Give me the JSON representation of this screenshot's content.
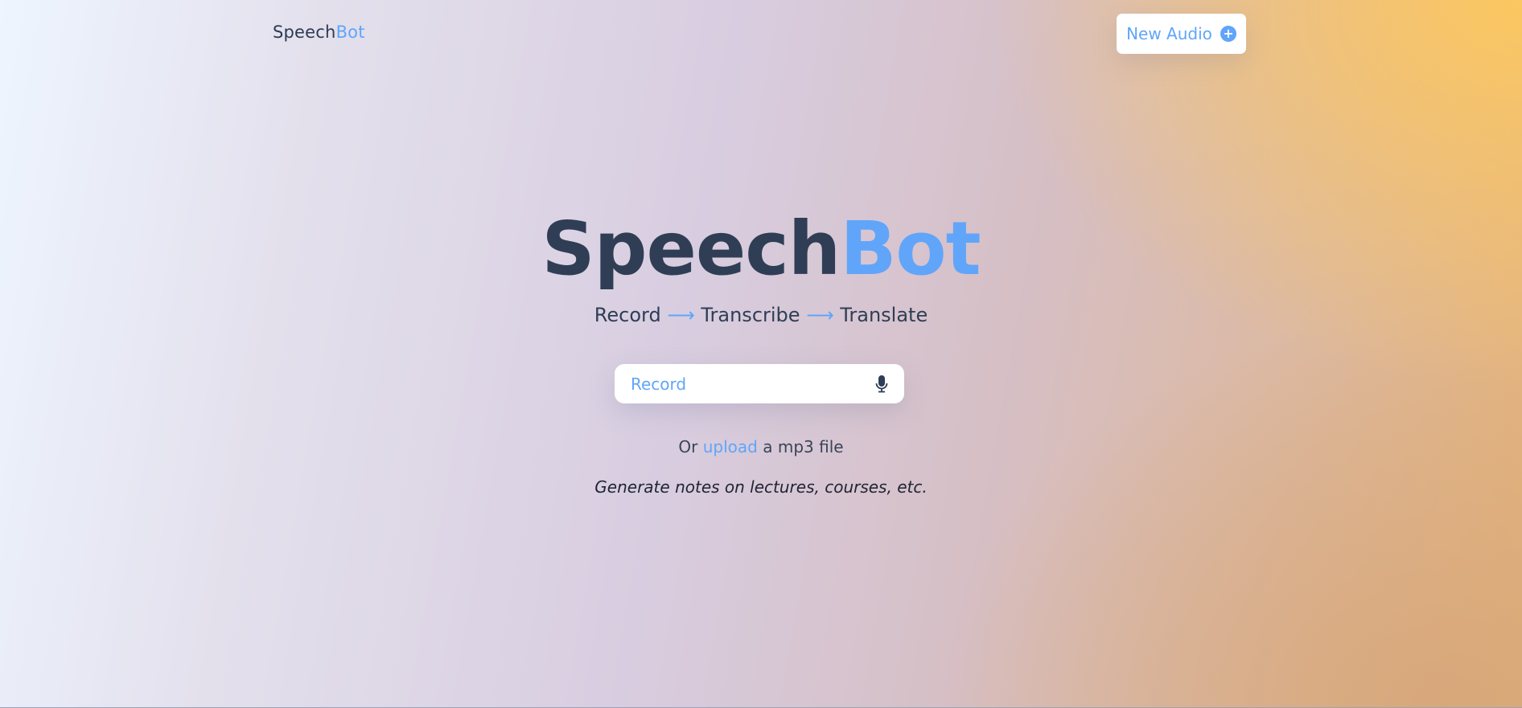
{
  "header": {
    "logo_part1": "Speech",
    "logo_part2": "Bot",
    "new_audio_label": "New Audio",
    "new_audio_icon": "plus-circle-icon"
  },
  "hero": {
    "title_part1": "Speech",
    "title_part2": "Bot",
    "tagline": {
      "step1": "Record",
      "arrow1": "⟶",
      "step2": "Transcribe",
      "arrow2": "⟶",
      "step3": "Translate"
    }
  },
  "record": {
    "label": "Record",
    "icon": "microphone-icon"
  },
  "upload": {
    "prefix": "Or",
    "link_text": "upload",
    "suffix": "a mp3 file"
  },
  "notes": {
    "text": "Generate notes on lectures, courses, etc."
  },
  "colors": {
    "accent": "#60a5fa",
    "text_dark": "#2f3e55"
  }
}
